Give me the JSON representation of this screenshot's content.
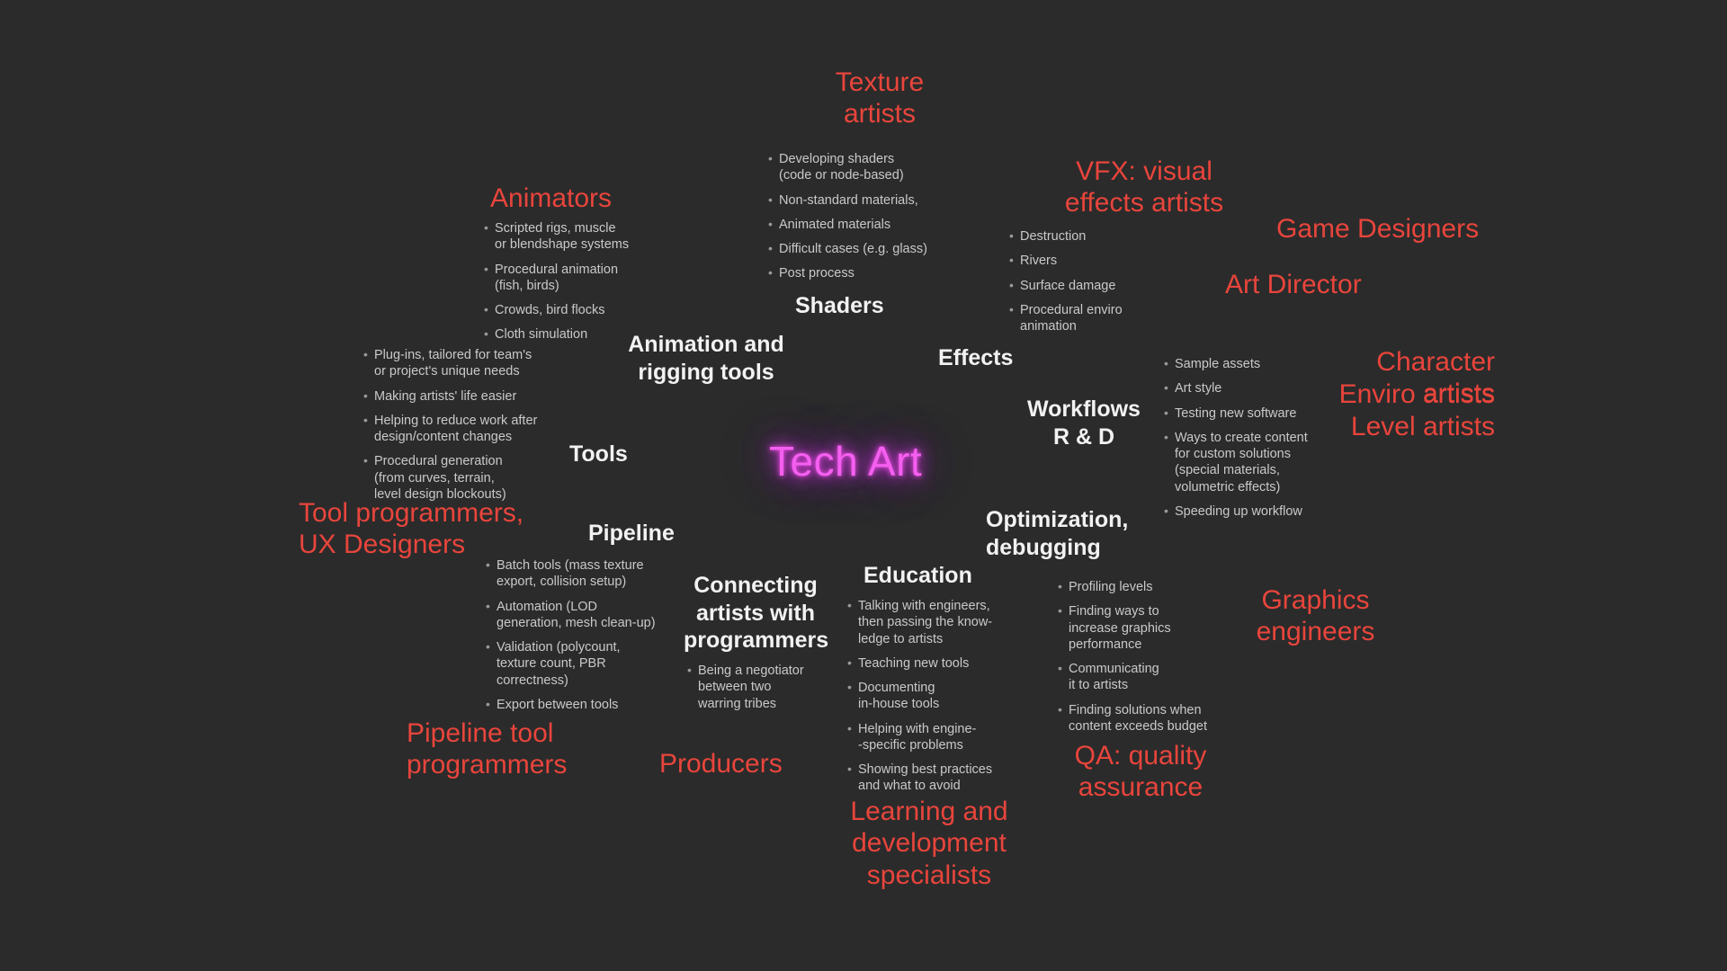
{
  "canvas": {
    "background": "#2b2b2b",
    "accent_red": "#e8453c",
    "heading_white": "#f2f2f2",
    "body_grey": "#c9c9c9",
    "center_magenta": "#f45ff0"
  },
  "center": {
    "title": "Tech Art"
  },
  "roles": {
    "texture_artists": "Texture\nartists",
    "animators": "Animators",
    "vfx_artists": "VFX: visual\neffects artists",
    "game_designers": "Game Designers",
    "art_director": "Art Director",
    "character_artists": "Character artists",
    "enviro_artists": "Enviro artists",
    "level_artists": "Level artists",
    "tool_programmers": "Tool programmers,\nUX Designers",
    "pipeline_tool_programmers": "Pipeline tool\nprogrammers",
    "producers": "Producers",
    "learning_development": "Learning and\ndevelopment\nspecialists",
    "qa": "QA: quality\nassurance",
    "graphics_engineers": "Graphics\nengineers"
  },
  "categories": {
    "shaders": {
      "heading": "Shaders",
      "bullets": [
        "Developing shaders\n(code or node-based)",
        "Non-standard materials,",
        "Animated materials",
        "Difficult cases (e.g. glass)",
        "Post process"
      ]
    },
    "animation_rigging": {
      "heading": "Animation and\nrigging tools",
      "bullets": [
        "Scripted rigs, muscle\nor blendshape systems",
        "Procedural animation\n(fish, birds)",
        "Crowds, bird flocks",
        "Cloth simulation"
      ]
    },
    "tools": {
      "heading": "Tools",
      "bullets": [
        "Plug-ins, tailored for team's\nor project's unique needs",
        "Making artists' life easier",
        "Helping to reduce work after\ndesign/content changes",
        "Procedural generation\n(from curves, terrain,\nlevel design blockouts)"
      ]
    },
    "pipeline": {
      "heading": "Pipeline",
      "bullets": [
        "Batch tools (mass texture\nexport, collision setup)",
        "Automation (LOD\ngeneration, mesh clean-up)",
        "Validation (polycount,\ntexture count, PBR\ncorrectness)",
        "Export between tools"
      ]
    },
    "connecting": {
      "heading": "Connecting\nartists with\nprogrammers",
      "bullets": [
        "Being a negotiator\nbetween two\nwarring tribes"
      ]
    },
    "education": {
      "heading": "Education",
      "bullets": [
        "Talking with engineers,\nthen passing the know-\nledge to artists",
        "Teaching new tools",
        "Documenting\nin-house tools",
        "Helping with engine-\n-specific problems",
        "Showing best practices\nand what to avoid"
      ]
    },
    "effects": {
      "heading": "Effects",
      "bullets": [
        "Destruction",
        "Rivers",
        "Surface damage",
        "Procedural enviro\nanimation"
      ]
    },
    "workflows": {
      "heading": "Workflows\nR & D",
      "bullets": [
        "Sample assets",
        "Art style",
        "Testing new software",
        "Ways to create content\nfor custom solutions\n(special materials,\nvolumetric effects)",
        "Speeding up workflow"
      ]
    },
    "optimization": {
      "heading": "Optimization,\ndebugging",
      "bullets": [
        "Profiling levels",
        "Finding ways to\nincrease graphics\nperformance",
        "Communicating\nit to artists",
        "Finding solutions when\ncontent exceeds budget"
      ]
    }
  }
}
